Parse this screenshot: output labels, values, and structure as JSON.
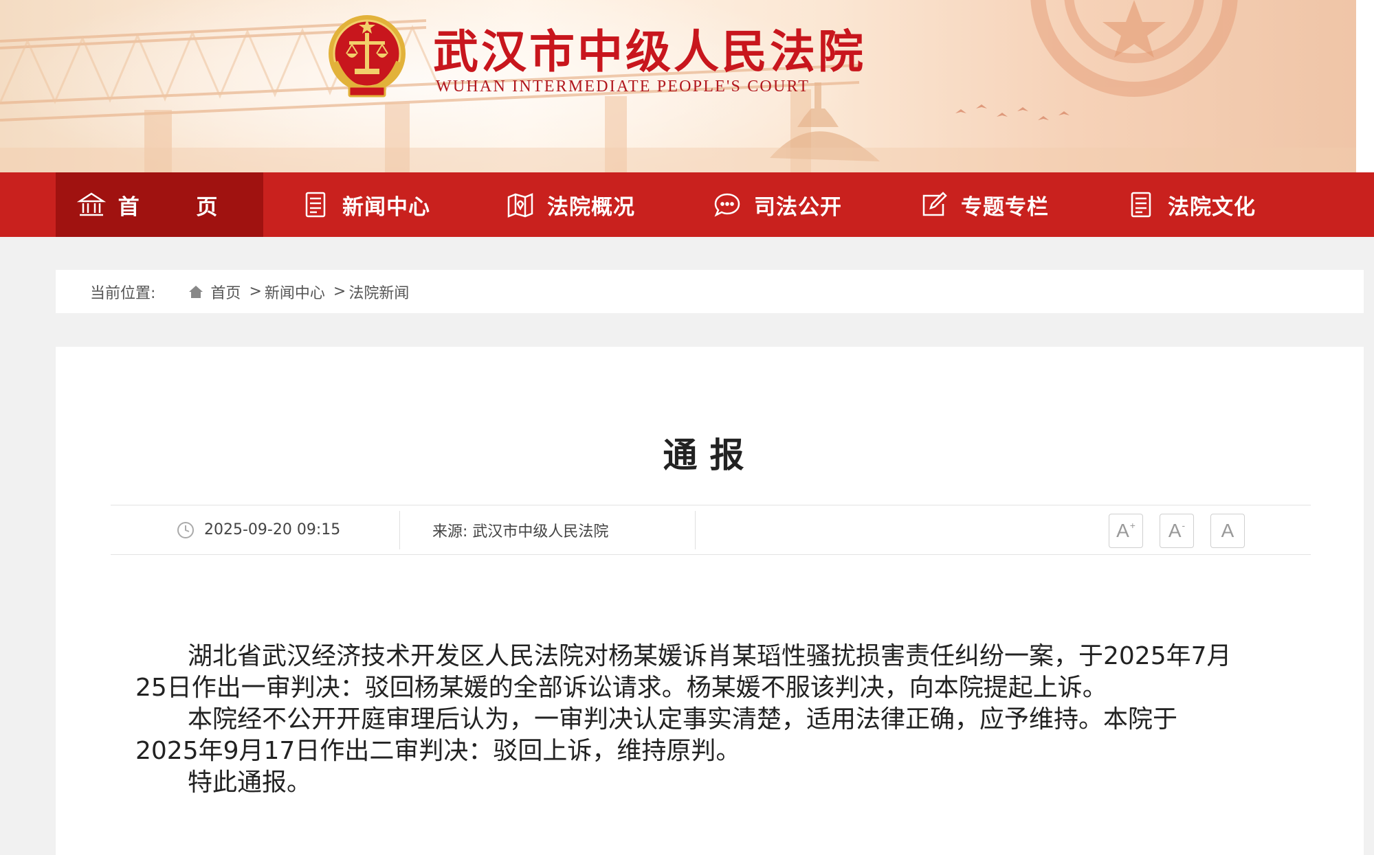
{
  "header": {
    "court_name_cn": "武汉市中级人民法院",
    "court_name_en": "WUHAN INTERMEDIATE PEOPLE'S COURT"
  },
  "nav": {
    "items": [
      {
        "label": "首 页",
        "icon": "home-icon",
        "active": true
      },
      {
        "label": "新闻中心",
        "icon": "document-icon"
      },
      {
        "label": "法院概况",
        "icon": "map-icon"
      },
      {
        "label": "司法公开",
        "icon": "chat-icon"
      },
      {
        "label": "专题专栏",
        "icon": "edit-icon"
      },
      {
        "label": "法院文化",
        "icon": "document-icon"
      }
    ]
  },
  "breadcrumb": {
    "label": "当前位置:",
    "items": [
      "首页",
      "新闻中心",
      "法院新闻"
    ],
    "separator": ">"
  },
  "article": {
    "title": "通报",
    "datetime": "2025-09-20 09:15",
    "source": "来源: 武汉市中级人民法院",
    "font_buttons": [
      {
        "label": "A",
        "suffix": "+"
      },
      {
        "label": "A",
        "suffix": "-"
      },
      {
        "label": "A",
        "suffix": ""
      }
    ],
    "paragraphs": [
      "湖北省武汉经济技术开发区人民法院对杨某媛诉肖某瑫性骚扰损害责任纠纷一案，于2025年7月25日作出一审判决：驳回杨某媛的全部诉讼请求。杨某媛不服该判决，向本院提起上诉。",
      "本院经不公开开庭审理后认为，一审判决认定事实清楚，适用法律正确，应予维持。本院于2025年9月17日作出二审判决：驳回上诉，维持原判。",
      "特此通报。"
    ]
  },
  "colors": {
    "nav_red": "#c9211e",
    "nav_active": "#a01210",
    "brand_red": "#c8161d"
  }
}
